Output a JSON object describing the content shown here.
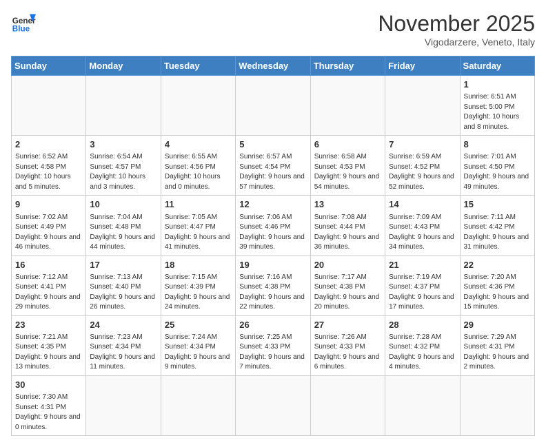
{
  "logo": {
    "text_general": "General",
    "text_blue": "Blue"
  },
  "header": {
    "title": "November 2025",
    "location": "Vigodarzere, Veneto, Italy"
  },
  "weekdays": [
    "Sunday",
    "Monday",
    "Tuesday",
    "Wednesday",
    "Thursday",
    "Friday",
    "Saturday"
  ],
  "weeks": [
    [
      {
        "day": "",
        "info": ""
      },
      {
        "day": "",
        "info": ""
      },
      {
        "day": "",
        "info": ""
      },
      {
        "day": "",
        "info": ""
      },
      {
        "day": "",
        "info": ""
      },
      {
        "day": "",
        "info": ""
      },
      {
        "day": "1",
        "info": "Sunrise: 6:51 AM\nSunset: 5:00 PM\nDaylight: 10 hours and 8 minutes."
      }
    ],
    [
      {
        "day": "2",
        "info": "Sunrise: 6:52 AM\nSunset: 4:58 PM\nDaylight: 10 hours and 5 minutes."
      },
      {
        "day": "3",
        "info": "Sunrise: 6:54 AM\nSunset: 4:57 PM\nDaylight: 10 hours and 3 minutes."
      },
      {
        "day": "4",
        "info": "Sunrise: 6:55 AM\nSunset: 4:56 PM\nDaylight: 10 hours and 0 minutes."
      },
      {
        "day": "5",
        "info": "Sunrise: 6:57 AM\nSunset: 4:54 PM\nDaylight: 9 hours and 57 minutes."
      },
      {
        "day": "6",
        "info": "Sunrise: 6:58 AM\nSunset: 4:53 PM\nDaylight: 9 hours and 54 minutes."
      },
      {
        "day": "7",
        "info": "Sunrise: 6:59 AM\nSunset: 4:52 PM\nDaylight: 9 hours and 52 minutes."
      },
      {
        "day": "8",
        "info": "Sunrise: 7:01 AM\nSunset: 4:50 PM\nDaylight: 9 hours and 49 minutes."
      }
    ],
    [
      {
        "day": "9",
        "info": "Sunrise: 7:02 AM\nSunset: 4:49 PM\nDaylight: 9 hours and 46 minutes."
      },
      {
        "day": "10",
        "info": "Sunrise: 7:04 AM\nSunset: 4:48 PM\nDaylight: 9 hours and 44 minutes."
      },
      {
        "day": "11",
        "info": "Sunrise: 7:05 AM\nSunset: 4:47 PM\nDaylight: 9 hours and 41 minutes."
      },
      {
        "day": "12",
        "info": "Sunrise: 7:06 AM\nSunset: 4:46 PM\nDaylight: 9 hours and 39 minutes."
      },
      {
        "day": "13",
        "info": "Sunrise: 7:08 AM\nSunset: 4:44 PM\nDaylight: 9 hours and 36 minutes."
      },
      {
        "day": "14",
        "info": "Sunrise: 7:09 AM\nSunset: 4:43 PM\nDaylight: 9 hours and 34 minutes."
      },
      {
        "day": "15",
        "info": "Sunrise: 7:11 AM\nSunset: 4:42 PM\nDaylight: 9 hours and 31 minutes."
      }
    ],
    [
      {
        "day": "16",
        "info": "Sunrise: 7:12 AM\nSunset: 4:41 PM\nDaylight: 9 hours and 29 minutes."
      },
      {
        "day": "17",
        "info": "Sunrise: 7:13 AM\nSunset: 4:40 PM\nDaylight: 9 hours and 26 minutes."
      },
      {
        "day": "18",
        "info": "Sunrise: 7:15 AM\nSunset: 4:39 PM\nDaylight: 9 hours and 24 minutes."
      },
      {
        "day": "19",
        "info": "Sunrise: 7:16 AM\nSunset: 4:38 PM\nDaylight: 9 hours and 22 minutes."
      },
      {
        "day": "20",
        "info": "Sunrise: 7:17 AM\nSunset: 4:38 PM\nDaylight: 9 hours and 20 minutes."
      },
      {
        "day": "21",
        "info": "Sunrise: 7:19 AM\nSunset: 4:37 PM\nDaylight: 9 hours and 17 minutes."
      },
      {
        "day": "22",
        "info": "Sunrise: 7:20 AM\nSunset: 4:36 PM\nDaylight: 9 hours and 15 minutes."
      }
    ],
    [
      {
        "day": "23",
        "info": "Sunrise: 7:21 AM\nSunset: 4:35 PM\nDaylight: 9 hours and 13 minutes."
      },
      {
        "day": "24",
        "info": "Sunrise: 7:23 AM\nSunset: 4:34 PM\nDaylight: 9 hours and 11 minutes."
      },
      {
        "day": "25",
        "info": "Sunrise: 7:24 AM\nSunset: 4:34 PM\nDaylight: 9 hours and 9 minutes."
      },
      {
        "day": "26",
        "info": "Sunrise: 7:25 AM\nSunset: 4:33 PM\nDaylight: 9 hours and 7 minutes."
      },
      {
        "day": "27",
        "info": "Sunrise: 7:26 AM\nSunset: 4:33 PM\nDaylight: 9 hours and 6 minutes."
      },
      {
        "day": "28",
        "info": "Sunrise: 7:28 AM\nSunset: 4:32 PM\nDaylight: 9 hours and 4 minutes."
      },
      {
        "day": "29",
        "info": "Sunrise: 7:29 AM\nSunset: 4:31 PM\nDaylight: 9 hours and 2 minutes."
      }
    ],
    [
      {
        "day": "30",
        "info": "Sunrise: 7:30 AM\nSunset: 4:31 PM\nDaylight: 9 hours and 0 minutes."
      },
      {
        "day": "",
        "info": ""
      },
      {
        "day": "",
        "info": ""
      },
      {
        "day": "",
        "info": ""
      },
      {
        "day": "",
        "info": ""
      },
      {
        "day": "",
        "info": ""
      },
      {
        "day": "",
        "info": ""
      }
    ]
  ]
}
